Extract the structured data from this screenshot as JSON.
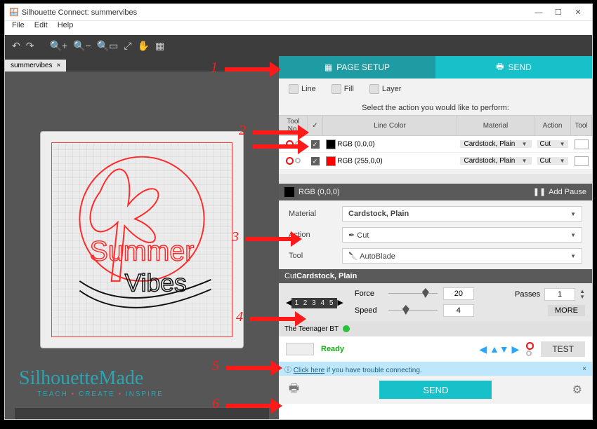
{
  "window": {
    "title": "Silhouette Connect: summervibes",
    "buttons": {
      "min": "—",
      "max": "☐",
      "close": "✕"
    }
  },
  "menu": {
    "file": "File",
    "edit": "Edit",
    "help": "Help"
  },
  "document_tab": {
    "name": "summervibes",
    "close": "×"
  },
  "right_tabs": {
    "page_setup": "PAGE SETUP",
    "send": "SEND"
  },
  "modes": {
    "line": "Line",
    "fill": "Fill",
    "layer": "Layer"
  },
  "action_prompt": "Select the action you would like to perform:",
  "grid": {
    "headers": {
      "toolno": "Tool No.",
      "chk": "✓",
      "linecolor": "Line Color",
      "material": "Material",
      "action": "Action",
      "tool": "Tool"
    },
    "rows": [
      {
        "swatch": "#000000",
        "color_label": "RGB (0,0,0)",
        "material": "Cardstock, Plain",
        "action": "Cut"
      },
      {
        "swatch": "#ff0000",
        "color_label": "RGB (255,0,0)",
        "material": "Cardstock, Plain",
        "action": "Cut"
      }
    ]
  },
  "section": {
    "title": "RGB (0,0,0)",
    "add_pause_icon": "❚❚",
    "add_pause": "Add Pause"
  },
  "form": {
    "material_label": "Material",
    "material_value": "Cardstock, Plain",
    "action_label": "Action",
    "action_value": "Cut",
    "tool_label": "Tool",
    "tool_value": "AutoBlade"
  },
  "cut": {
    "header_prefix": "Cut ",
    "header_material": "Cardstock, Plain",
    "depth_nums": "1 2 3 4 5",
    "force_label": "Force",
    "force_value": "20",
    "speed_label": "Speed",
    "speed_value": "4",
    "passes_label": "Passes",
    "passes_value": "1",
    "more": "MORE"
  },
  "connection": {
    "device": "The Teenager BT",
    "status": "Ready",
    "test": "TEST"
  },
  "help": {
    "info_icon": "ⓘ",
    "link": "Click here",
    "rest": " if you have trouble connecting.",
    "close": "×"
  },
  "send_button": "SEND",
  "annotations": {
    "n1": "1",
    "n2": "2",
    "n3": "3",
    "n4": "4",
    "n5": "5",
    "n6": "6"
  },
  "signature": {
    "brand": "SilhouetteMade",
    "sub_a": "TEACH",
    "sub_b": "CREATE",
    "sub_c": "INSPIRE",
    "dot": " • "
  }
}
